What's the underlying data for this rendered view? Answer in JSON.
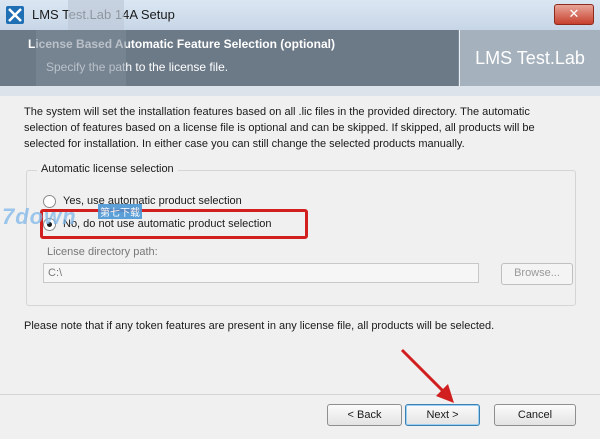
{
  "window": {
    "title": "LMS Test.Lab 14A Setup",
    "close_glyph": "✕"
  },
  "banner": {
    "title": "License Based Automatic Feature Selection (optional)",
    "subtitle": "Specify the path to the license file.",
    "brand": "LMS Test.Lab"
  },
  "main": {
    "description": "The system will set the installation features based on all .lic files in the provided directory. The automatic selection of features based on a license file is optional and can be skipped. If skipped, all products will be selected for installation. In either case you can still change the selected products manually.",
    "group_title": "Automatic license selection",
    "option_yes": "Yes, use automatic product selection",
    "option_no": "No, do not use automatic product selection",
    "selected_option": "no",
    "dir_label": "License directory path:",
    "dir_value": "C:\\",
    "browse_label": "Browse...",
    "note": "Please note that if any token features are present in any license file, all products will be selected."
  },
  "footer": {
    "back_label": "< Back",
    "next_label": "Next >",
    "cancel_label": "Cancel"
  },
  "watermark": {
    "text": "7down",
    "cn_text": "第七下载"
  },
  "colors": {
    "highlight": "#d11f1f",
    "banner": "#6c7a88",
    "brand_panel": "#a5b1bd"
  }
}
